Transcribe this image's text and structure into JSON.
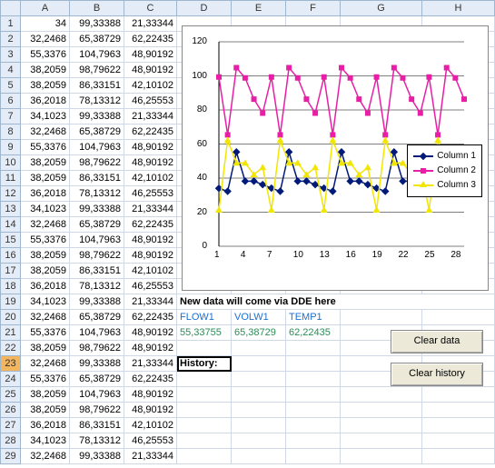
{
  "columns": [
    "A",
    "B",
    "C",
    "D",
    "E",
    "F",
    "G",
    "H"
  ],
  "selected_row_header": 23,
  "rows": [
    {
      "r": 1,
      "A": "34",
      "B": "99,33388",
      "C": "21,33344"
    },
    {
      "r": 2,
      "A": "32,2468",
      "B": "65,38729",
      "C": "62,22435"
    },
    {
      "r": 3,
      "A": "55,3376",
      "B": "104,7963",
      "C": "48,90192"
    },
    {
      "r": 4,
      "A": "38,2059",
      "B": "98,79622",
      "C": "48,90192"
    },
    {
      "r": 5,
      "A": "38,2059",
      "B": "86,33151",
      "C": "42,10102"
    },
    {
      "r": 6,
      "A": "36,2018",
      "B": "78,13312",
      "C": "46,25553"
    },
    {
      "r": 7,
      "A": "34,1023",
      "B": "99,33388",
      "C": "21,33344"
    },
    {
      "r": 8,
      "A": "32,2468",
      "B": "65,38729",
      "C": "62,22435"
    },
    {
      "r": 9,
      "A": "55,3376",
      "B": "104,7963",
      "C": "48,90192"
    },
    {
      "r": 10,
      "A": "38,2059",
      "B": "98,79622",
      "C": "48,90192"
    },
    {
      "r": 11,
      "A": "38,2059",
      "B": "86,33151",
      "C": "42,10102"
    },
    {
      "r": 12,
      "A": "36,2018",
      "B": "78,13312",
      "C": "46,25553"
    },
    {
      "r": 13,
      "A": "34,1023",
      "B": "99,33388",
      "C": "21,33344"
    },
    {
      "r": 14,
      "A": "32,2468",
      "B": "65,38729",
      "C": "62,22435"
    },
    {
      "r": 15,
      "A": "55,3376",
      "B": "104,7963",
      "C": "48,90192"
    },
    {
      "r": 16,
      "A": "38,2059",
      "B": "98,79622",
      "C": "48,90192"
    },
    {
      "r": 17,
      "A": "38,2059",
      "B": "86,33151",
      "C": "42,10102"
    },
    {
      "r": 18,
      "A": "36,2018",
      "B": "78,13312",
      "C": "46,25553"
    },
    {
      "r": 19,
      "A": "34,1023",
      "B": "99,33388",
      "C": "21,33344",
      "D": "New data will come via DDE here",
      "D_bold": true,
      "span": true
    },
    {
      "r": 20,
      "A": "32,2468",
      "B": "65,38729",
      "C": "62,22435",
      "D": "FLOW1",
      "E": "VOLW1",
      "F": "TEMP1",
      "blueDEF": true
    },
    {
      "r": 21,
      "A": "55,3376",
      "B": "104,7963",
      "C": "48,90192",
      "D": "55,33755",
      "E": "65,38729",
      "F": "62,22435",
      "greenDEF": true
    },
    {
      "r": 22,
      "A": "38,2059",
      "B": "98,79622",
      "C": "48,90192"
    },
    {
      "r": 23,
      "A": "32,2468",
      "B": "99,33388",
      "C": "21,33344",
      "D": "History:",
      "D_bold": true,
      "selD": true
    },
    {
      "r": 24,
      "A": "55,3376",
      "B": "65,38729",
      "C": "62,22435"
    },
    {
      "r": 25,
      "A": "38,2059",
      "B": "104,7963",
      "C": "48,90192"
    },
    {
      "r": 26,
      "A": "38,2059",
      "B": "98,79622",
      "C": "48,90192"
    },
    {
      "r": 27,
      "A": "36,2018",
      "B": "86,33151",
      "C": "42,10102"
    },
    {
      "r": 28,
      "A": "34,1023",
      "B": "78,13312",
      "C": "46,25553"
    },
    {
      "r": 29,
      "A": "32,2468",
      "B": "99,33388",
      "C": "21,33344"
    }
  ],
  "buttons": {
    "clear_data": "Clear data",
    "clear_history": "Clear history"
  },
  "chart_data": {
    "type": "line",
    "x": [
      1,
      2,
      3,
      4,
      5,
      6,
      7,
      8,
      9,
      10,
      11,
      12,
      13,
      14,
      15,
      16,
      17,
      18,
      19,
      20,
      21,
      22,
      23,
      24,
      25,
      26,
      27,
      28,
      29
    ],
    "xticks": [
      1,
      4,
      7,
      10,
      13,
      16,
      19,
      22,
      25,
      28
    ],
    "ylim": [
      0,
      120
    ],
    "yticks": [
      0,
      20,
      40,
      60,
      80,
      100,
      120
    ],
    "legend": [
      "Column 1",
      "Column 2",
      "Column 3"
    ],
    "series": [
      {
        "name": "Column 1",
        "color": "#001a7a",
        "marker": "diamond",
        "values": [
          34,
          32.25,
          55.34,
          38.21,
          38.21,
          36.2,
          34.1,
          32.25,
          55.34,
          38.21,
          38.21,
          36.2,
          34.1,
          32.25,
          55.34,
          38.21,
          38.21,
          36.2,
          34.1,
          32.25,
          55.34,
          38.21,
          38.21,
          36.2,
          34.1,
          32.25,
          55.34,
          38.21,
          38.21
        ]
      },
      {
        "name": "Column 2",
        "color": "#e81ea6",
        "marker": "square",
        "values": [
          99.33,
          65.39,
          104.8,
          98.8,
          86.33,
          78.13,
          99.33,
          65.39,
          104.8,
          98.8,
          86.33,
          78.13,
          99.33,
          65.39,
          104.8,
          98.8,
          86.33,
          78.13,
          99.33,
          65.39,
          104.8,
          98.8,
          86.33,
          78.13,
          99.33,
          65.39,
          104.8,
          98.8,
          86.33
        ]
      },
      {
        "name": "Column 3",
        "color": "#f2e600",
        "marker": "triangle",
        "values": [
          21.33,
          62.22,
          48.9,
          48.9,
          42.1,
          46.26,
          21.33,
          62.22,
          48.9,
          48.9,
          42.1,
          46.26,
          21.33,
          62.22,
          48.9,
          48.9,
          42.1,
          46.26,
          21.33,
          62.22,
          48.9,
          48.9,
          42.1,
          46.26,
          21.33,
          62.22,
          48.9,
          48.9,
          42.1
        ]
      }
    ]
  }
}
